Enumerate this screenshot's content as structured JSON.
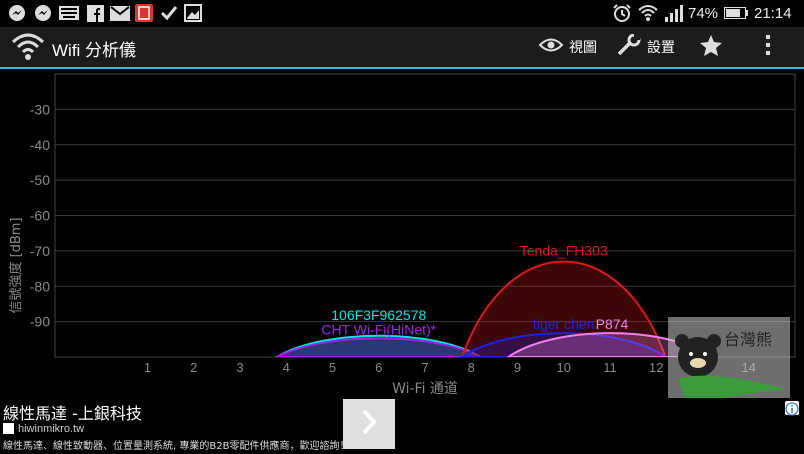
{
  "statusbar": {
    "battery": "74%",
    "time": "21:14",
    "icons": [
      "messenger-icon",
      "messenger-icon",
      "keyboard-icon",
      "facebook-icon",
      "mail-icon",
      "app-icon",
      "check-icon",
      "photo-icon",
      "alarm-icon",
      "wifi-icon",
      "signal-icon",
      "battery-icon"
    ]
  },
  "actionbar": {
    "title": "Wifi 分析儀",
    "view_label": "視圖",
    "settings_label": "設置"
  },
  "chart_data": {
    "type": "area",
    "ylabel": "信號強度 [dBm]",
    "xlabel": "Wi-Fi 通道",
    "y_ticks": [
      "-30",
      "-40",
      "-50",
      "-60",
      "-70",
      "-80",
      "-90"
    ],
    "x_ticks": [
      "1",
      "2",
      "3",
      "4",
      "5",
      "6",
      "7",
      "8",
      "9",
      "10",
      "11",
      "12",
      "13",
      "14"
    ],
    "ylim": [
      -100,
      -20
    ],
    "xlim": [
      -1,
      15
    ],
    "grid": true,
    "series": [
      {
        "name": "106F3F962578",
        "channel": 6,
        "peak": -92,
        "color": "#00e5e5"
      },
      {
        "name": "CHT Wi-Fi(HiNet)*",
        "channel": 6,
        "peak": -93,
        "color": "#a020f0"
      },
      {
        "name": "Tenda_FH303",
        "channel": 10,
        "peak": -64,
        "color": "#e01818"
      },
      {
        "name": "tiger chen",
        "channel": 10,
        "peak": -91,
        "color": "#2020e8"
      },
      {
        "name": "P874",
        "channel": 11,
        "peak": -91,
        "color": "#f080f0"
      }
    ]
  },
  "ad": {
    "title": "線性馬達 -上銀科技",
    "url": "hiwinmikro.tw",
    "description": "線性馬達、線性致動器、位置量測系統, 專業的B2B零配件供應商，歡迎諮詢！",
    "arrow": "›"
  },
  "watermark": {
    "text": "台灣熊"
  }
}
